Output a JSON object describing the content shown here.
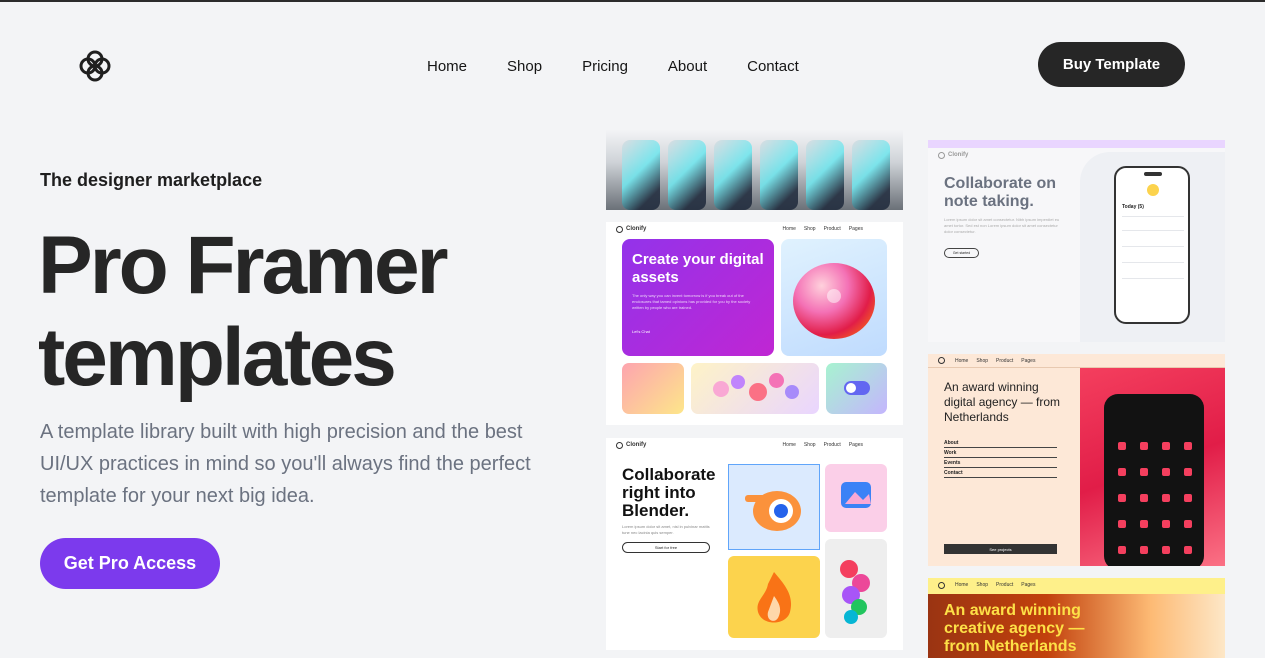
{
  "header": {
    "logo_icon": "clover-logo-icon",
    "nav": [
      "Home",
      "Shop",
      "Pricing",
      "About",
      "Contact"
    ],
    "buy_button": "Buy Template"
  },
  "hero": {
    "kicker": "The designer marketplace",
    "title_line1": "Pro Framer",
    "title_line2": "templates",
    "description": "A template library built with high precision and the best UI/UX practices in mind so you'll always find the perfect template for your next big idea.",
    "cta": "Get Pro Access"
  },
  "colors": {
    "accent": "#7c3aed",
    "dark": "#262626",
    "background": "#f3f4f6"
  },
  "previews": {
    "create": {
      "brand": "Clonify",
      "nav": [
        "Home",
        "Shop",
        "Product",
        "Pages"
      ],
      "heading": "Create your digital assets",
      "body": "The only way you can invent tomorrow is if you break out of the enclosures that tamed opinions has provided for you by the society written by people who are trained.",
      "link": "Let's Chat"
    },
    "blender": {
      "brand": "Clonify",
      "nav": [
        "Home",
        "Shop",
        "Product",
        "Pages"
      ],
      "heading": "Collaborate right into Blender.",
      "body": "Lorem ipsum dolor sit amet, nisl in pulvinar mattis tune nec lacinia quis semper.",
      "button": "Start for free"
    },
    "note": {
      "brand": "Clonify",
      "heading": "Collaborate on note taking.",
      "body": "Lorem ipsum dolor sit amet consectetur. Nibh ipsum imperdiet eu amet tortor. Sed est non Lorem ipsum dolor sit amet consectetur dolor consectetur.",
      "button": "Get started",
      "phone_title": "Today (5)"
    },
    "award": {
      "nav": [
        "Home",
        "Shop",
        "Product",
        "Pages"
      ],
      "heading": "An award winning digital agency — from Netherlands",
      "links": [
        "About",
        "Work",
        "Events",
        "Contact"
      ],
      "button": "See projects"
    },
    "yellow": {
      "nav": [
        "Home",
        "Shop",
        "Product",
        "Pages"
      ],
      "heading": "An award winning creative agency — from Netherlands"
    }
  }
}
